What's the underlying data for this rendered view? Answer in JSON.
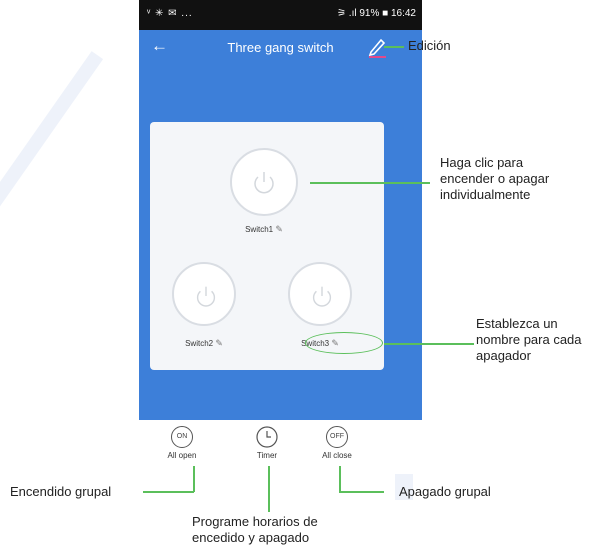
{
  "status_bar": {
    "left_icons": "ᵛ ✳ ✉ ...",
    "right_text": "⚞ .ıl 91% ■ 16:42"
  },
  "header": {
    "title": "Three gang switch"
  },
  "switches": [
    {
      "label": "Switch1"
    },
    {
      "label": "Switch2"
    },
    {
      "label": "Switch3"
    }
  ],
  "bottom": {
    "all_open": {
      "icon_text": "ON",
      "label": "All open"
    },
    "timer": {
      "label": "Timer"
    },
    "all_close": {
      "icon_text": "OFF",
      "label": "All close"
    }
  },
  "annotations": {
    "edit": "Edición",
    "toggle": [
      "Haga clic para",
      "encender o apagar",
      "individualmente"
    ],
    "name": [
      "Establezca un",
      "nombre para cada",
      "apagador"
    ],
    "group_on": "Encendido grupal",
    "group_off": "Apagado grupal",
    "schedule": [
      "Programe horarios de",
      "encedido y apagado"
    ]
  },
  "colors": {
    "accent": "#3d7fd9",
    "annotation_line": "#5bbf5b"
  }
}
